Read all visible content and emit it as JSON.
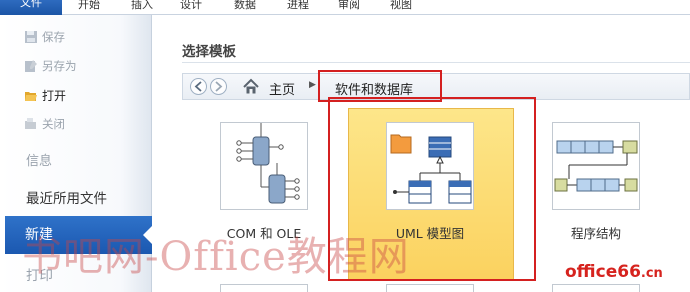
{
  "ribbon": {
    "tabs": [
      "文件",
      "开始",
      "插入",
      "设计",
      "数据",
      "进程",
      "审阅",
      "视图"
    ]
  },
  "backstage": {
    "save": "保存",
    "save_as": "另存为",
    "open": "打开",
    "close": "关闭",
    "info": "信息",
    "recent": "最近所用文件",
    "new": "新建",
    "print": "打印"
  },
  "main": {
    "heading": "选择模板",
    "breadcrumb": {
      "home": "主页",
      "current": "软件和数据库"
    },
    "templates": [
      {
        "label": "COM 和 OLE"
      },
      {
        "label": "UML 模型图",
        "selected": true
      },
      {
        "label": "程序结构"
      }
    ]
  },
  "watermark": {
    "text": "书吧网-Office教程网",
    "site_main": "office66",
    "site_suffix": ".cn"
  },
  "colors": {
    "accent": "#1b58b0",
    "selected_tile": "#fbd25f",
    "highlight_box": "#d42020"
  }
}
